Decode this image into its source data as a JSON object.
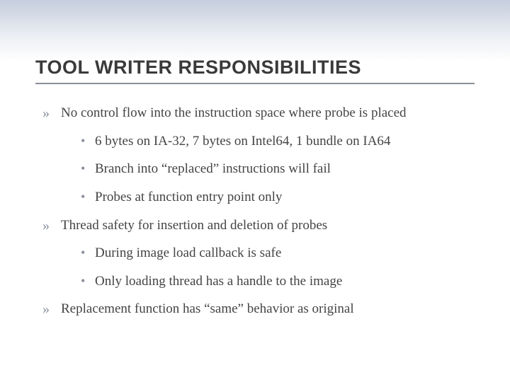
{
  "slide": {
    "title": "TOOL WRITER RESPONSIBILITIES",
    "bullets": [
      {
        "text": "No control flow into the instruction space where probe is placed",
        "sub": [
          "6 bytes on IA-32, 7 bytes on Intel64, 1 bundle on IA64",
          "Branch into “replaced” instructions will fail",
          "Probes at function entry point only"
        ]
      },
      {
        "text": "Thread safety for insertion and deletion of probes",
        "sub": [
          "During image load callback is safe",
          "Only loading thread has a handle to the image"
        ]
      },
      {
        "text": "Replacement function has “same” behavior as original",
        "sub": []
      }
    ]
  }
}
